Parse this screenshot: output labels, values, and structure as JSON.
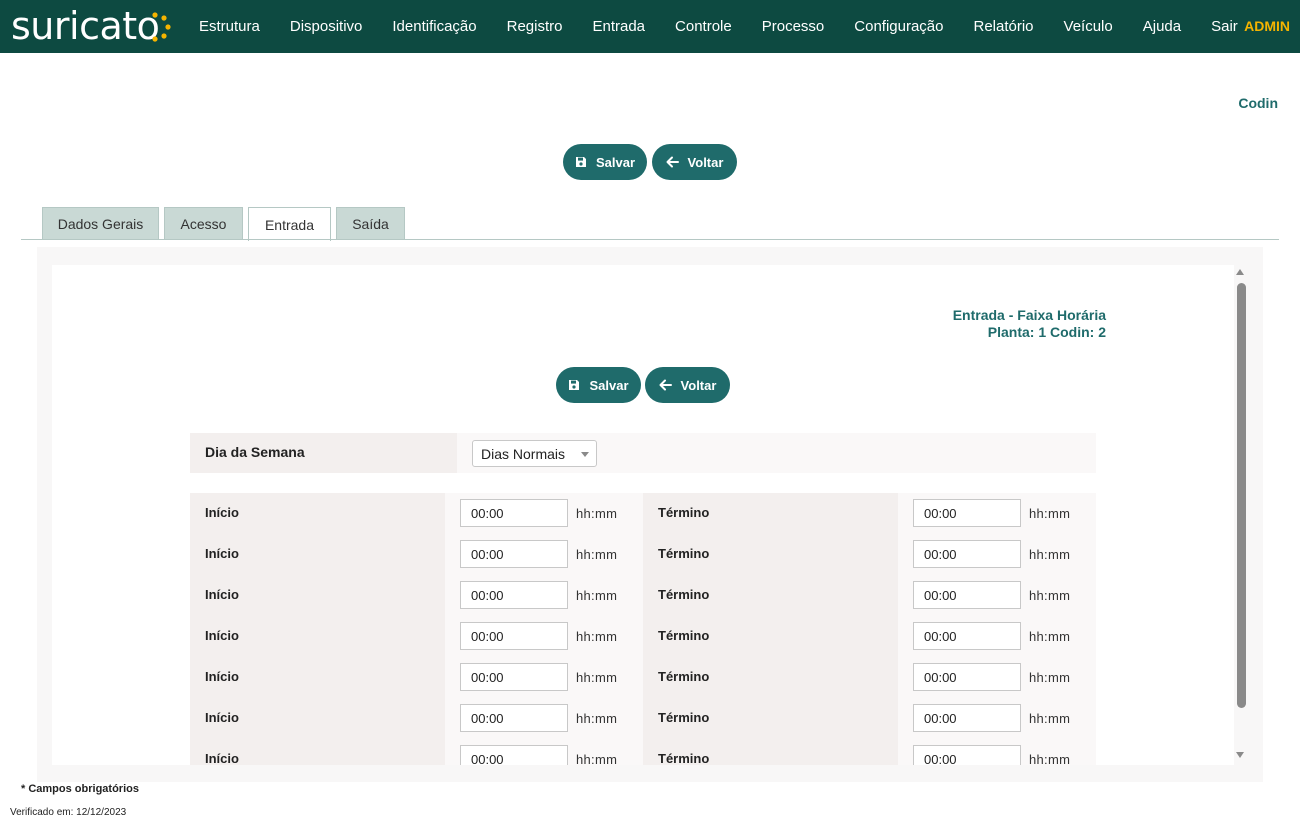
{
  "app": {
    "logo_text": "suricato",
    "nav": [
      "Estrutura",
      "Dispositivo",
      "Identificação",
      "Registro",
      "Entrada",
      "Controle",
      "Processo",
      "Configuração",
      "Relatório",
      "Veículo",
      "Ajuda",
      "Sair"
    ],
    "user": "ADMIN",
    "colors": {
      "header": "#0d4a41",
      "accent": "#1f6b6b",
      "user": "#f5b400",
      "tab_inactive": "#c9d9d5"
    }
  },
  "page": {
    "codin_label": "Codin",
    "save_label": "Salvar",
    "back_label": "Voltar",
    "tabs": [
      {
        "label": "Dados Gerais",
        "active": false
      },
      {
        "label": "Acesso",
        "active": false
      },
      {
        "label": "Entrada",
        "active": true
      },
      {
        "label": "Saída",
        "active": false
      }
    ]
  },
  "form": {
    "title_line1": "Entrada - Faixa Horária",
    "title_line2": "Planta: 1 Codin: 2",
    "save_label": "Salvar",
    "back_label": "Voltar",
    "day_label": "Dia da Semana",
    "day_value": "Dias Normais",
    "rows": [
      {
        "start_label": "Início",
        "start_value": "00:00",
        "start_fmt": "hh:mm",
        "end_label": "Término",
        "end_value": "00:00",
        "end_fmt": "hh:mm"
      },
      {
        "start_label": "Início",
        "start_value": "00:00",
        "start_fmt": "hh:mm",
        "end_label": "Término",
        "end_value": "00:00",
        "end_fmt": "hh:mm"
      },
      {
        "start_label": "Início",
        "start_value": "00:00",
        "start_fmt": "hh:mm",
        "end_label": "Término",
        "end_value": "00:00",
        "end_fmt": "hh:mm"
      },
      {
        "start_label": "Início",
        "start_value": "00:00",
        "start_fmt": "hh:mm",
        "end_label": "Término",
        "end_value": "00:00",
        "end_fmt": "hh:mm"
      },
      {
        "start_label": "Início",
        "start_value": "00:00",
        "start_fmt": "hh:mm",
        "end_label": "Término",
        "end_value": "00:00",
        "end_fmt": "hh:mm"
      },
      {
        "start_label": "Início",
        "start_value": "00:00",
        "start_fmt": "hh:mm",
        "end_label": "Término",
        "end_value": "00:00",
        "end_fmt": "hh:mm"
      },
      {
        "start_label": "Início",
        "start_value": "00:00",
        "start_fmt": "hh:mm",
        "end_label": "Término",
        "end_value": "00:00",
        "end_fmt": "hh:mm"
      }
    ]
  },
  "footer": {
    "required_note": "* Campos obrigatórios",
    "verified": "Verificado em: 12/12/2023"
  }
}
